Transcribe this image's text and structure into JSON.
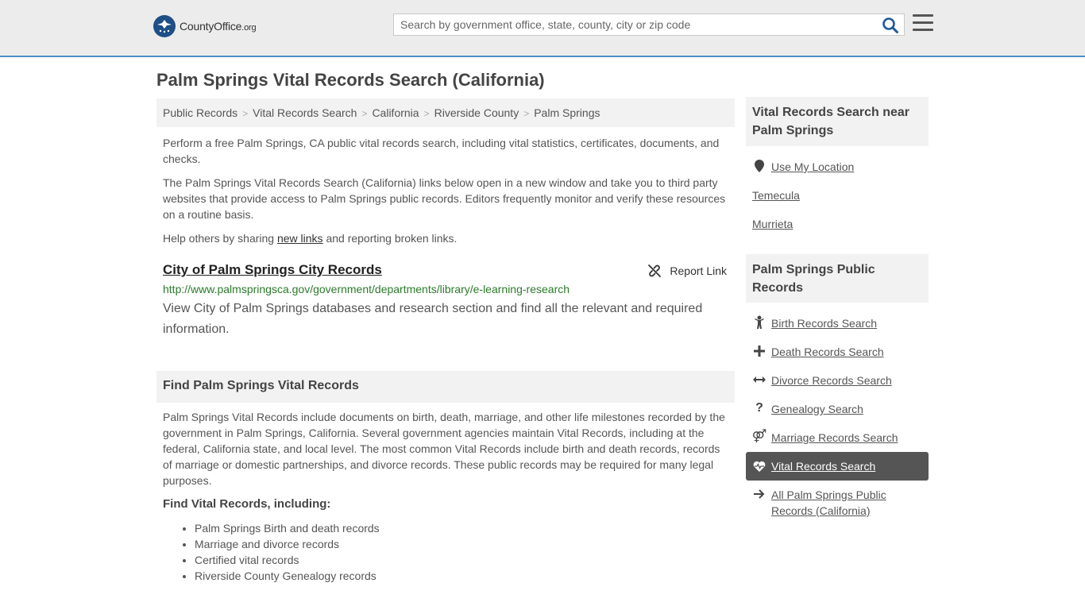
{
  "header": {
    "logo_main": "CountyOffice",
    "logo_suffix": ".org",
    "search_placeholder": "Search by government office, state, county, city or zip code"
  },
  "page": {
    "title": "Palm Springs Vital Records Search (California)"
  },
  "breadcrumb": [
    "Public Records",
    "Vital Records Search",
    "California",
    "Riverside County",
    "Palm Springs"
  ],
  "intro": {
    "p1": "Perform a free Palm Springs, CA public vital records search, including vital statistics, certificates, documents, and checks.",
    "p2": "The Palm Springs Vital Records Search (California) links below open in a new window and take you to third party websites that provide access to Palm Springs public records. Editors frequently monitor and verify these resources on a routine basis.",
    "p3_before": "Help others by sharing ",
    "p3_link": "new links",
    "p3_after": " and reporting broken links."
  },
  "listing": {
    "title": "City of Palm Springs City Records",
    "report_label": "Report Link",
    "url": "http://www.palmspringsca.gov/government/departments/library/e-learning-research",
    "description": "View City of Palm Springs databases and research section and find all the relevant and required information."
  },
  "find_section": {
    "heading": "Find Palm Springs Vital Records",
    "body": "Palm Springs Vital Records include documents on birth, death, marriage, and other life milestones recorded by the government in Palm Springs, California. Several government agencies maintain Vital Records, including at the federal, California state, and local level. The most common Vital Records include birth and death records, records of marriage or domestic partnerships, and divorce records. These public records may be required for many legal purposes.",
    "subheading": "Find Vital Records, including:",
    "items": [
      "Palm Springs Birth and death records",
      "Marriage and divorce records",
      "Certified vital records",
      "Riverside County Genealogy records"
    ]
  },
  "sidebar": {
    "nearby_heading": "Vital Records Search near Palm Springs",
    "use_location": "Use My Location",
    "nearby": [
      "Temecula",
      "Murrieta"
    ],
    "public_heading": "Palm Springs Public Records",
    "public_links": [
      {
        "label": "Birth Records Search",
        "icon": "child-icon"
      },
      {
        "label": "Death Records Search",
        "icon": "cross-icon"
      },
      {
        "label": "Divorce Records Search",
        "icon": "arrows-horizontal-icon"
      },
      {
        "label": "Genealogy Search",
        "icon": "question-icon"
      },
      {
        "label": "Marriage Records Search",
        "icon": "venus-mars-icon"
      },
      {
        "label": "Vital Records Search",
        "icon": "heartbeat-icon",
        "active": true
      },
      {
        "label": "All Palm Springs Public Records (California)",
        "icon": "arrow-right-icon"
      }
    ]
  }
}
